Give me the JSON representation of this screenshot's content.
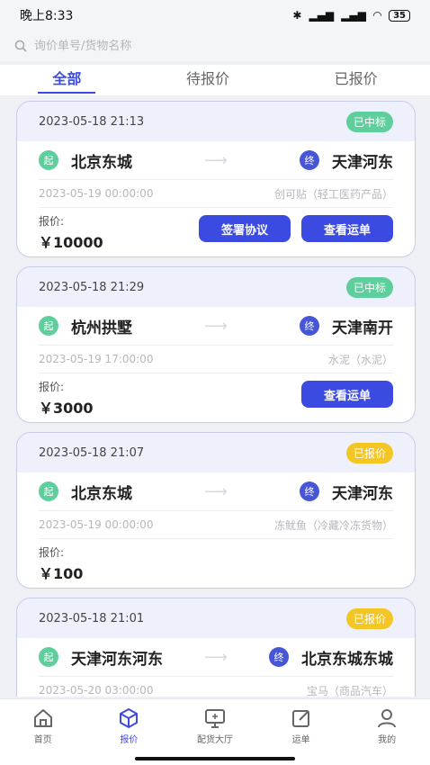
{
  "status": {
    "time": "晚上8:33",
    "battery": "35"
  },
  "search": {
    "placeholder": "询价单号/货物名称"
  },
  "tabs": [
    {
      "label": "全部"
    },
    {
      "label": "待报价"
    },
    {
      "label": "已报价"
    }
  ],
  "cards": [
    {
      "time": "2023-05-18 21:13",
      "badge": "已中标",
      "start_tag": "起",
      "from": "北京东城",
      "end_tag": "终",
      "to": "天津河东",
      "date": "2023-05-19 00:00:00",
      "cargo": "创可贴（轻工医药产品）",
      "price_label": "报价:",
      "price": "￥10000",
      "btn_sign": "签署协议",
      "btn_view": "查看运单"
    },
    {
      "time": "2023-05-18 21:29",
      "badge": "已中标",
      "start_tag": "起",
      "from": "杭州拱墅",
      "end_tag": "终",
      "to": "天津南开",
      "date": "2023-05-19 17:00:00",
      "cargo": "水泥（水泥）",
      "price_label": "报价:",
      "price": "￥3000",
      "btn_view": "查看运单"
    },
    {
      "time": "2023-05-18 21:07",
      "badge": "已报价",
      "start_tag": "起",
      "from": "北京东城",
      "end_tag": "终",
      "to": "天津河东",
      "date": "2023-05-19 00:00:00",
      "cargo": "冻鱿鱼（冷藏冷冻货物）",
      "price_label": "报价:",
      "price": "￥100"
    },
    {
      "time": "2023-05-18 21:01",
      "badge": "已报价",
      "start_tag": "起",
      "from": "天津河东河东",
      "end_tag": "终",
      "to": "北京东城东城",
      "date": "2023-05-20 03:00:00",
      "cargo": "宝马（商品汽车）"
    }
  ],
  "tabbar": [
    {
      "label": "首页",
      "icon": "home-icon"
    },
    {
      "label": "报价",
      "icon": "box-icon"
    },
    {
      "label": "配货大厅",
      "icon": "monitor-icon"
    },
    {
      "label": "运单",
      "icon": "edit-icon"
    },
    {
      "label": "我的",
      "icon": "user-icon"
    }
  ],
  "colors": {
    "accent": "#3b4ae0",
    "won": "#5ecf9c",
    "quoted": "#f3c623"
  }
}
